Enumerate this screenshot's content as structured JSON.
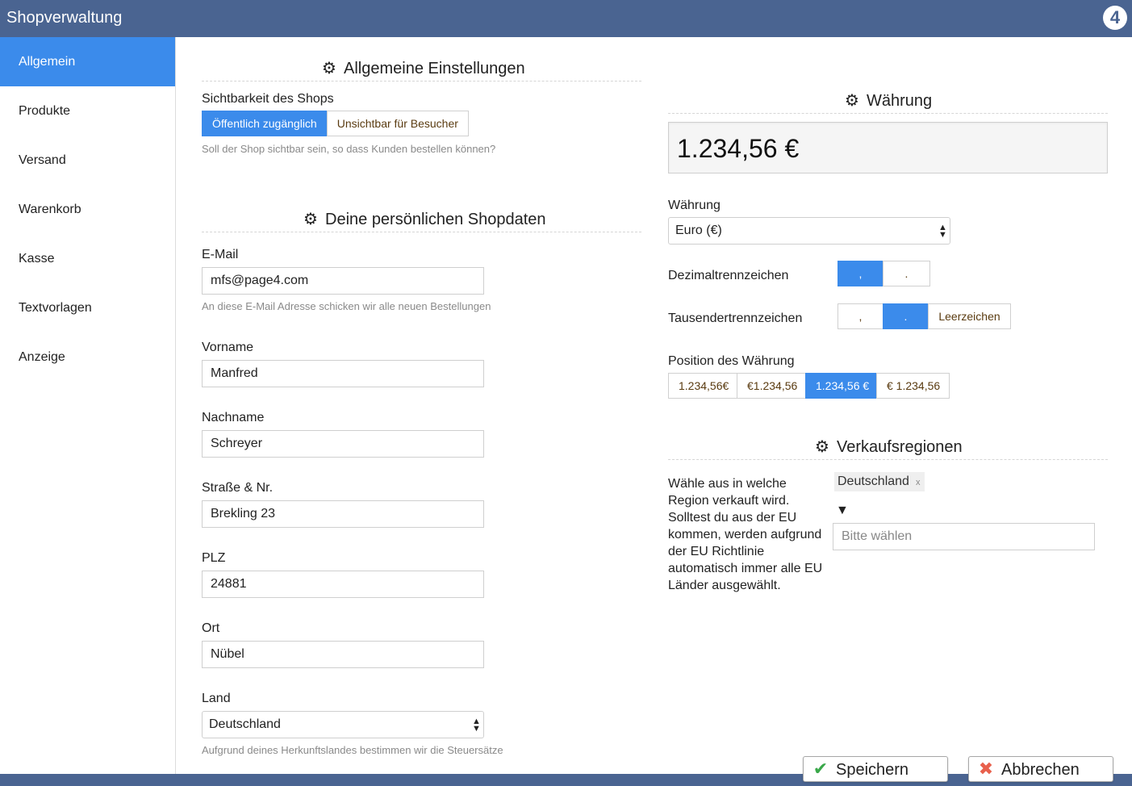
{
  "app": {
    "title": "Shopverwaltung",
    "logo_text": "4"
  },
  "sidebar": {
    "items": [
      {
        "label": "Allgemein",
        "active": true
      },
      {
        "label": "Produkte"
      },
      {
        "label": "Versand"
      },
      {
        "label": "Warenkorb"
      },
      {
        "label": "Kasse"
      },
      {
        "label": "Textvorlagen"
      },
      {
        "label": "Anzeige"
      }
    ]
  },
  "general": {
    "title": "Allgemeine Einstellungen",
    "visibility_label": "Sichtbarkeit des Shops",
    "visibility_options": [
      "Öffentlich zugänglich",
      "Unsichtbar für Besucher"
    ],
    "visibility_selected": "Öffentlich zugänglich",
    "visibility_help": "Soll der Shop sichtbar sein, so dass Kunden bestellen können?"
  },
  "shopdata": {
    "title": "Deine persönlichen Shopdaten",
    "email_label": "E-Mail",
    "email_value": "mfs@page4.com",
    "email_help": "An diese E-Mail Adresse schicken wir alle neuen Bestellungen",
    "firstname_label": "Vorname",
    "firstname_value": "Manfred",
    "lastname_label": "Nachname",
    "lastname_value": "Schreyer",
    "street_label": "Straße & Nr.",
    "street_value": "Brekling 23",
    "zip_label": "PLZ",
    "zip_value": "24881",
    "city_label": "Ort",
    "city_value": "Nübel",
    "country_label": "Land",
    "country_value": "Deutschland",
    "country_help": "Aufgrund deines Herkunftslandes bestimmen wir die Steuersätze"
  },
  "currency": {
    "title": "Währung",
    "preview": "1.234,56 €",
    "currency_label": "Währung",
    "currency_value": "Euro (€)",
    "decimal_label": "Dezimaltrennzeichen",
    "decimal_options": [
      ",",
      "."
    ],
    "decimal_selected": ",",
    "thousand_label": "Tausendertrennzeichen",
    "thousand_options": [
      ",",
      ".",
      "Leerzeichen"
    ],
    "thousand_selected": ".",
    "position_label": "Position des Währung",
    "position_options": [
      "1.234,56€",
      "€1.234,56",
      "1.234,56 €",
      "€ 1.234,56"
    ],
    "position_selected": "1.234,56 €"
  },
  "regions": {
    "title": "Verkaufsregionen",
    "description": "Wähle aus in welche Region verkauft wird. Solltest du aus der EU kommen, werden aufgrund der EU Richtlinie automatisch immer alle EU Länder ausgewählt.",
    "selected_tag": "Deutschland",
    "tag_remove": "x",
    "dropdown_glyph": "▼",
    "placeholder": "Bitte wählen"
  },
  "actions": {
    "save_label": "Speichern",
    "cancel_label": "Abbrechen"
  },
  "colors": {
    "topbar": "#4a6491",
    "accent": "#3b8beb",
    "save_icon": "#3aa84a",
    "cancel_icon": "#e8604c"
  },
  "icons": {
    "section": "gear-icon",
    "save": "checkmark-icon",
    "cancel": "cross-icon"
  }
}
